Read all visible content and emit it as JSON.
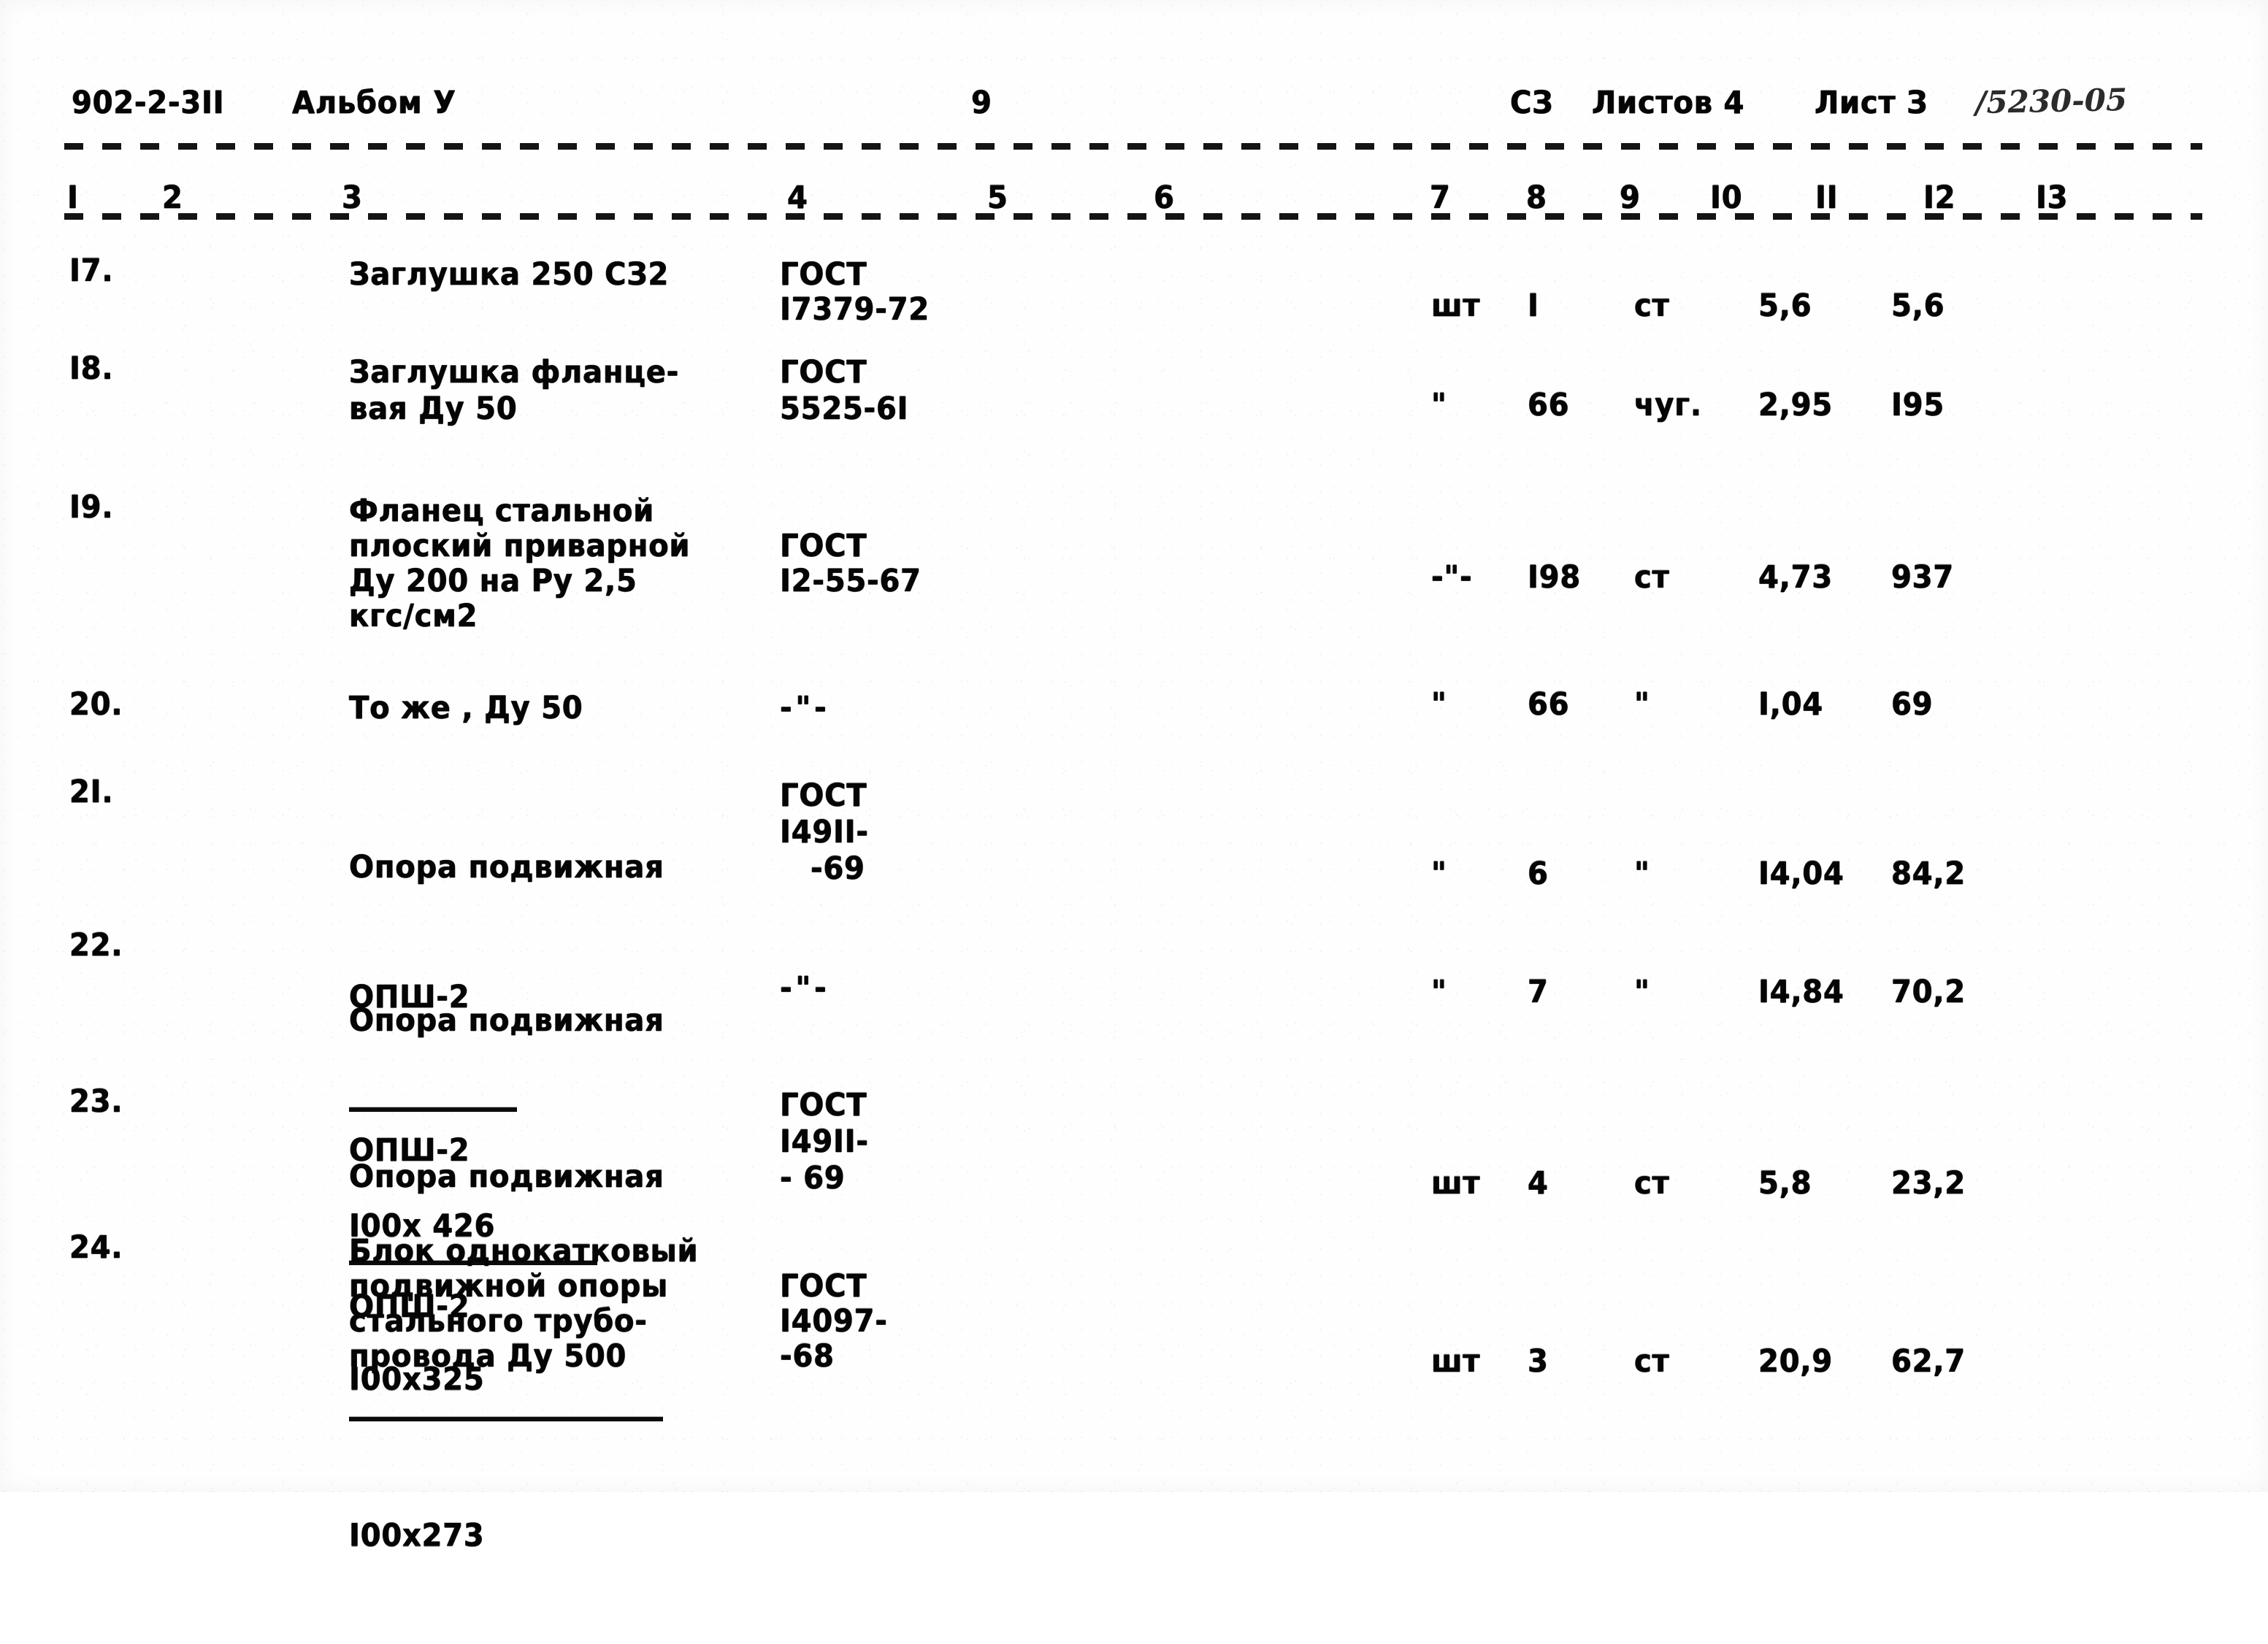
{
  "header": {
    "doc_code": "902-2-3II",
    "album_label": "Альбом У",
    "page_number": "9",
    "sheet_mark": "СЗ",
    "sheets_total_label": "Листов 4",
    "sheet_current_label": "Лист З",
    "stamp_number": "/5230-05"
  },
  "table": {
    "column_numbers": [
      "I",
      "2",
      "3",
      "4",
      "5",
      "6",
      "7",
      "8",
      "9",
      "I0",
      "II",
      "I2",
      "I3"
    ],
    "rows": [
      {
        "num": "I7.",
        "name_lines": [
          "Заглушка 250 СЗ2"
        ],
        "gost_lines": [
          "ГОСТ",
          "I7379-72"
        ],
        "unit": "шт",
        "qty": "I",
        "material": "ст",
        "unit_weight": "5,6",
        "total_weight": "5,6"
      },
      {
        "num": "I8.",
        "name_lines": [
          "Заглушка фланце-",
          "вая Ду 50"
        ],
        "gost_lines": [
          "ГОСТ",
          "5525-6I"
        ],
        "unit": "\"",
        "qty": "66",
        "material": "чуг.",
        "unit_weight": "2,95",
        "total_weight": "I95"
      },
      {
        "num": "I9.",
        "name_lines": [
          "Фланец стальной",
          "плоский приварной",
          "Ду 200 на Ру 2,5",
          "кгс/см2"
        ],
        "gost_lines": [
          "ГОСТ",
          "I2-55-67"
        ],
        "unit": "-\"-",
        "qty": "I98",
        "material": "ст",
        "unit_weight": "4,73",
        "total_weight": "937"
      },
      {
        "num": "20.",
        "name_lines": [
          "То же , Ду 50"
        ],
        "gost_lines": [
          "-\"-"
        ],
        "unit": "\"",
        "qty": "66",
        "material": "\"",
        "unit_weight": "I,04",
        "total_weight": "69"
      },
      {
        "num": "2I.",
        "name_lines": [
          "Опора подвижная",
          "ОПШ-2",
          "I00х 426"
        ],
        "gost_lines": [
          "ГОСТ",
          "I49II-",
          "-69"
        ],
        "unit": "\"",
        "qty": "6",
        "material": "\"",
        "unit_weight": "I4,04",
        "total_weight": "84,2"
      },
      {
        "num": "22.",
        "name_lines": [
          "Опора подвижная",
          "ОПШ-2",
          "I00х325"
        ],
        "gost_lines": [
          "-\"-"
        ],
        "unit": "\"",
        "qty": "7",
        "material": "\"",
        "unit_weight": "I4,84",
        "total_weight": "70,2"
      },
      {
        "num": "23.",
        "name_lines": [
          "Опора подвижная",
          "ОПШ-2",
          "I00х273"
        ],
        "gost_lines": [
          "ГОСТ",
          "I49II-",
          "- 69"
        ],
        "unit": "шт",
        "qty": "4",
        "material": "ст",
        "unit_weight": "5,8",
        "total_weight": "23,2"
      },
      {
        "num": "24.",
        "name_lines": [
          "Блок однокатковый",
          "подвижной опоры",
          "стального трубо-",
          "провода Ду 500"
        ],
        "gost_lines": [
          "ГОСТ",
          "I4097-",
          "-68"
        ],
        "unit": "шт",
        "qty": "3",
        "material": "ст",
        "unit_weight": "20,9",
        "total_weight": "62,7"
      }
    ]
  }
}
